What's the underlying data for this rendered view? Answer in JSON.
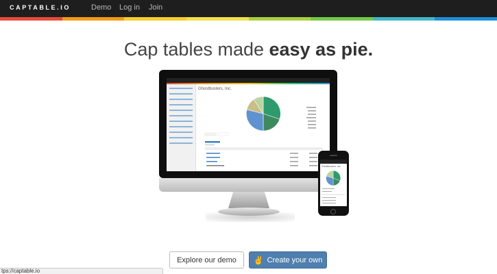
{
  "header": {
    "brand": "CAPTABLE.IO",
    "nav": [
      {
        "label": "Demo"
      },
      {
        "label": "Log in"
      },
      {
        "label": "Join"
      }
    ]
  },
  "stripe_colors": [
    "#e74c3c",
    "#f39c12",
    "#f7ce2b",
    "#f1e14a",
    "#a7d13c",
    "#73c948",
    "#44b6c9",
    "#1f8fd8"
  ],
  "hero": {
    "headline_plain": "Cap tables made ",
    "headline_bold": "easy as pie."
  },
  "screen": {
    "company": "Ghostbusters, Inc.",
    "pie_colors": [
      "#2e9a6e",
      "#3d8a5e",
      "#5e93cf",
      "#b8d4a0",
      "#c9a96a"
    ]
  },
  "phone": {
    "company": "Ghostbusters, Inc."
  },
  "actions": {
    "demo_label": "Explore our demo",
    "create_label": "Create your own"
  },
  "status_bar": {
    "url": "tps://captable.io"
  }
}
